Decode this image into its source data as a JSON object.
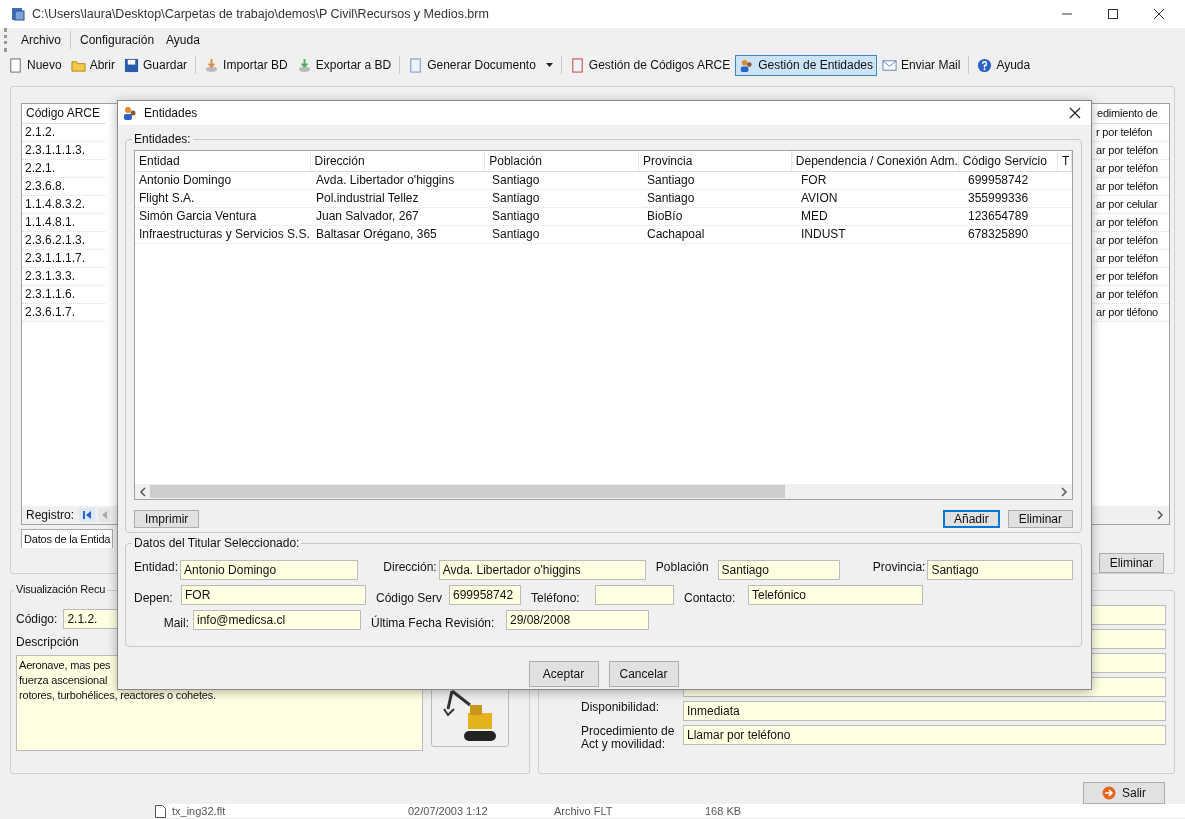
{
  "window": {
    "title": "C:\\Users\\laura\\Desktop\\Carpetas de trabajo\\demos\\P Civil\\Recursos y Medios.brm"
  },
  "menu": [
    "Archivo",
    "Configuración",
    "Ayuda"
  ],
  "toolbar": [
    [
      {
        "label": "Nuevo",
        "selected": false,
        "has_menu": false
      },
      {
        "label": "Abrir",
        "selected": false,
        "has_menu": false
      },
      {
        "label": "Guardar",
        "selected": false,
        "has_menu": false
      }
    ],
    [
      {
        "label": "Importar BD",
        "selected": false,
        "has_menu": false
      },
      {
        "label": "Exportar a BD",
        "selected": false,
        "has_menu": false
      }
    ],
    [
      {
        "label": "Generar Documento",
        "selected": false,
        "has_menu": true
      }
    ],
    [
      {
        "label": "Gestión de Códigos ARCE",
        "selected": false,
        "has_menu": false
      },
      {
        "label": "Gestión de Entidades",
        "selected": true,
        "has_menu": false
      },
      {
        "label": "Enviar Mail",
        "selected": false,
        "has_menu": false
      }
    ],
    [
      {
        "label": "Ayuda",
        "selected": false,
        "has_menu": false
      }
    ]
  ],
  "main": {
    "grid": {
      "column_1_header": "Código ARCE",
      "column_2_header": "edimiento de",
      "rows": [
        {
          "code": "2.1.2.",
          "column_2": "r por teléfon"
        },
        {
          "code": "2.3.1.1.1.3.",
          "column_2": "ar por teléfon"
        },
        {
          "code": "2.2.1.",
          "column_2": "ar por teléfon"
        },
        {
          "code": "2.3.6.8.",
          "column_2": "ar por teléfon"
        },
        {
          "code": "1.1.4.8.3.2.",
          "column_2": "ar por celular"
        },
        {
          "code": "1.1.4.8.1.",
          "column_2": "ar por teléfon"
        },
        {
          "code": "2.3.6.2.1.3.",
          "column_2": "ar por teléfon"
        },
        {
          "code": "2.3.1.1.1.7.",
          "column_2": "ar por teléfon"
        },
        {
          "code": "2.3.1.3.3.",
          "column_2": "er por teléfon"
        },
        {
          "code": "2.3.1.1.6.",
          "column_2": "ar por teléfon"
        },
        {
          "code": "2.3.6.1.7.",
          "column_2": "ar por tléfono"
        }
      ]
    },
    "record_label": "Registro:",
    "tab": "Datos de la Entida",
    "delete_button": "Eliminar"
  },
  "resource_view": {
    "title": "Visualización Recu",
    "code_label": "Código:",
    "code": "2.1.2.",
    "description_label": "Descripción",
    "description_lines": [
      "Aeronave, mas pes",
      "fuerza ascensional",
      "rotores, turbohélices, reactores o cohetes."
    ]
  },
  "details": [
    {
      "label": "Disponibilidad:",
      "value": "Inmediata"
    },
    {
      "label": "Procedimiento de Act y movilidad:",
      "value": "Llamar por teléfono"
    }
  ],
  "exit_button": "Salir",
  "background_file": {
    "name": "tx_ing32.flt",
    "date": "02/07/2003 1:12",
    "type": "Archivo FLT",
    "size": "168 KB"
  },
  "dialog": {
    "title": "Entidades",
    "list_title": "Entidades:",
    "columns": [
      "Entidad",
      "Dirección",
      "Población",
      "Provincia",
      "Dependencia / Conexión Adm.",
      "Código Servicio",
      "T"
    ],
    "rows": [
      [
        "Antonio Domingo",
        "Avda. Libertador o'higgins",
        "Santiago",
        "Santiago",
        "FOR",
        "699958742"
      ],
      [
        "Flight S.A.",
        "Pol.industrial Tellez",
        "Santiago",
        "Santiago",
        "AVION",
        "355999336"
      ],
      [
        "Simón Garcia Ventura",
        "Juan Salvador, 267",
        "Santiago",
        "BioBío",
        "MED",
        "123654789"
      ],
      [
        "Infraestructuras y Servicios S.S.",
        "Baltasar Orégano, 365",
        "Santiago",
        "Cachapoal",
        "INDUST",
        "678325890"
      ]
    ],
    "list_buttons": [
      {
        "label": "Imprimir",
        "focused": false
      },
      {
        "label": "Añadir",
        "focused": true
      },
      {
        "label": "Eliminar",
        "focused": false
      }
    ],
    "details_title": "Datos del Titular Seleccionado:",
    "fields": {
      "entidad": {
        "label": "Entidad:",
        "value": "Antonio Domingo"
      },
      "direccion": {
        "label": "Dirección:",
        "value": "Avda. Libertador o'higgins"
      },
      "poblacion": {
        "label": "Población",
        "value": "Santiago"
      },
      "provincia": {
        "label": "Provincia:",
        "value": "Santiago"
      },
      "depen": {
        "label": "Depen:",
        "value": "FOR"
      },
      "codigo": {
        "label": "Código Serv",
        "value": "699958742"
      },
      "telefono": {
        "label": "Teléfono:"
      },
      "contacto": {
        "label": "Contacto:",
        "value": "Telefónico"
      },
      "mail": {
        "label": "Mail:",
        "value": "info@medicsa.cl"
      },
      "fecha": {
        "label": "Última Fecha Revisión:",
        "value": "29/08/2008"
      }
    },
    "buttons": [
      "Aceptar",
      "Cancelar"
    ]
  }
}
